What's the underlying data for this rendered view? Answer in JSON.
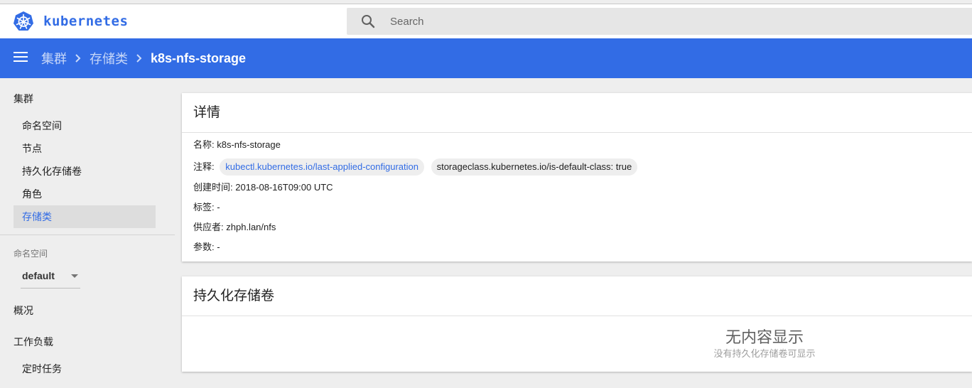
{
  "app": {
    "brand": "kubernetes"
  },
  "search": {
    "placeholder": "Search"
  },
  "breadcrumb": [
    "集群",
    "存储类",
    "k8s-nfs-storage"
  ],
  "sidebar": {
    "section_cluster": "集群",
    "cluster_items": [
      "命名空间",
      "节点",
      "持久化存储卷",
      "角色",
      "存储类"
    ],
    "active_item": "存储类",
    "namespace_label": "命名空间",
    "namespace_value": "default",
    "overview": "概况",
    "workloads": "工作负载",
    "workload_items": [
      "定时任务"
    ]
  },
  "details": {
    "title": "详情",
    "name_label": "名称:",
    "name_value": "k8s-nfs-storage",
    "annotations_label": "注释:",
    "annotation_link": "kubectl.kubernetes.io/last-applied-configuration",
    "annotation_kv": "storageclass.kubernetes.io/is-default-class:  true",
    "created_label": "创建时间:",
    "created_value": "2018-08-16T09:00 UTC",
    "labels_label": "标签:",
    "labels_value": "-",
    "provisioner_label": "供应者:",
    "provisioner_value": "zhph.lan/nfs",
    "params_label": "参数:",
    "params_value": "-"
  },
  "pv_card": {
    "title": "持久化存储卷",
    "empty_title": "无内容显示",
    "empty_subtitle": "没有持久化存储卷可显示"
  },
  "colors": {
    "accent": "#326ce5",
    "header_bg": "#326ce5"
  },
  "icons": [
    "kubernetes-logo",
    "search-icon",
    "menu-icon",
    "chevron-right-icon",
    "dropdown-arrow-icon"
  ]
}
